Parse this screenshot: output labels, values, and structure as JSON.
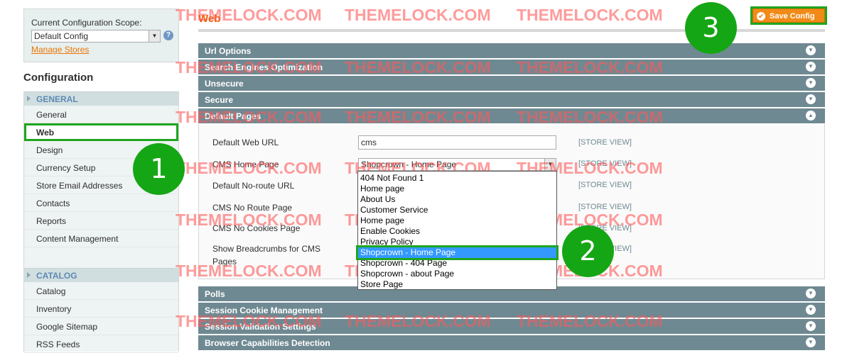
{
  "scope": {
    "label": "Current Configuration Scope:",
    "value": "Default Config",
    "manage_stores": "Manage Stores"
  },
  "sidebar": {
    "title": "Configuration",
    "groups": [
      {
        "label": "GENERAL",
        "items": [
          "General",
          "Web",
          "Design",
          "Currency Setup",
          "Store Email Addresses",
          "Contacts",
          "Reports",
          "Content Management"
        ]
      },
      {
        "label": "CATALOG",
        "items": [
          "Catalog",
          "Inventory",
          "Google Sitemap",
          "RSS Feeds"
        ]
      }
    ],
    "active_item": "Web"
  },
  "main": {
    "title": "Web",
    "save_label": "Save Config",
    "sections": [
      "Url Options",
      "Search Engines Optimization",
      "Unsecure",
      "Secure",
      "Default Pages",
      "Polls",
      "Session Cookie Management",
      "Session Validation Settings",
      "Browser Capabilities Detection"
    ],
    "fields": [
      {
        "label": "Default Web URL",
        "value": "cms",
        "scope": "[STORE VIEW]"
      },
      {
        "label": "CMS Home Page",
        "value": "Shopcrown - Home Page",
        "scope": "[STORE VIEW]"
      },
      {
        "label": "Default No-route URL",
        "scope": "[STORE VIEW]"
      },
      {
        "label": "CMS No Route Page",
        "scope": "[STORE VIEW]"
      },
      {
        "label": "CMS No Cookies Page",
        "scope": "[STORE VIEW]"
      },
      {
        "label": "Show Breadcrumbs for CMS",
        "label2": "Pages",
        "scope": "[STORE VIEW]"
      }
    ],
    "dropdown_options": [
      "404 Not Found 1",
      "Home page",
      "About Us",
      "Customer Service",
      "Home page",
      "Enable Cookies",
      "Privacy Policy",
      "Shopcrown - Home Page",
      "Shopcrown - 404 Page",
      "Shopcrown - about Page",
      "Store Page"
    ],
    "selected_option": "Shopcrown - Home Page"
  },
  "watermark": "THEMELOCK.COM",
  "steps": [
    "1",
    "2",
    "3"
  ],
  "colors": {
    "accent": "#eb5e00",
    "section_bar": "#6f8992",
    "highlight": "#1fa51f",
    "selection": "#3399ff"
  }
}
